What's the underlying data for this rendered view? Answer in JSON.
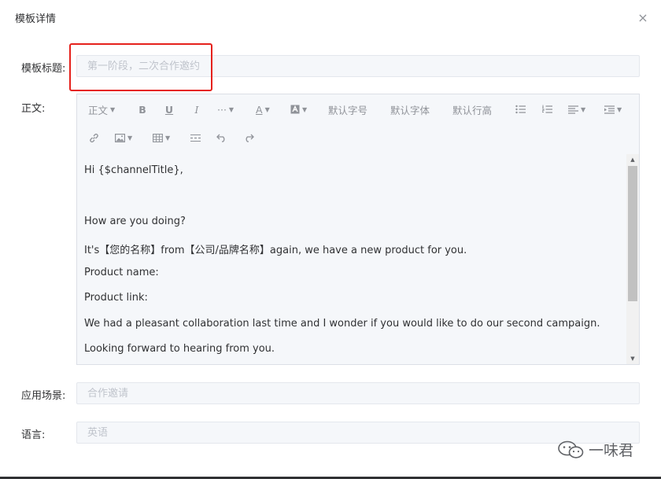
{
  "dialog": {
    "title": "模板详情",
    "close_glyph": "×"
  },
  "form": {
    "title_label": "模板标题:",
    "title_placeholder": "第一阶段，二次合作邀约",
    "body_label": "正文:",
    "scene_label": "应用场景:",
    "scene_placeholder": "合作邀请",
    "language_label": "语言:",
    "language_placeholder": "英语"
  },
  "toolbar": {
    "paragraph": "正文",
    "bold": "B",
    "underline": "U",
    "italic": "I",
    "more": "···",
    "font_color": "A",
    "bg_color_icon": "highlight-icon",
    "font_size": "默认字号",
    "font_family": "默认字体",
    "line_height": "默认行高",
    "bullet_list_icon": "bullet-list-icon",
    "ordered_list_icon": "ordered-list-icon",
    "align_icon": "align-left-icon",
    "indent_icon": "indent-icon",
    "link_icon": "link-icon",
    "image_icon": "image-icon",
    "table_icon": "table-icon",
    "divider_icon": "divider-icon",
    "undo_icon": "undo-icon",
    "redo_icon": "redo-icon"
  },
  "content": {
    "lines": [
      "Hi {$channelTitle},",
      "How are you doing?",
      "It's【您的名称】from【公司/品牌名称】again, we have a new product for you.",
      "Product name:",
      "Product link:",
      "We had a pleasant collaboration last time and I wonder if you would like to do our second campaign.",
      "Looking forward to hearing from you."
    ]
  },
  "watermark": {
    "text": "一味君",
    "icon": "wechat-icon"
  },
  "colors": {
    "highlight_box": "#e5211c",
    "field_bg": "#f5f7fa",
    "placeholder": "#c0c4cc"
  }
}
